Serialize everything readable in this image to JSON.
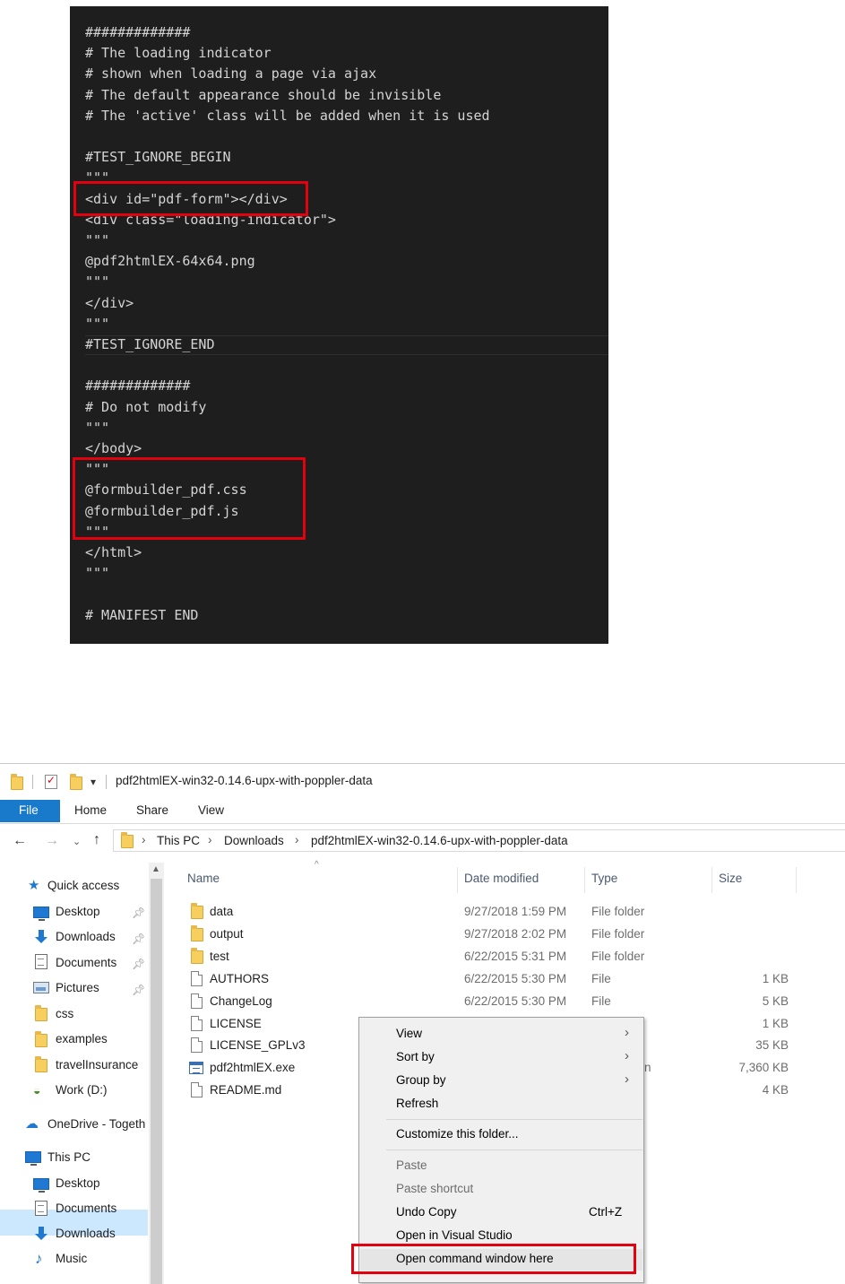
{
  "code": {
    "lines": [
      "#############",
      "# The loading indicator",
      "# shown when loading a page via ajax",
      "# The default appearance should be invisible",
      "# The 'active' class will be added when it is used",
      "",
      "#TEST_IGNORE_BEGIN",
      "\"\"\"",
      "<div id=\"pdf-form\"></div>",
      "<div class=\"loading-indicator\">",
      "\"\"\"",
      "@pdf2htmlEX-64x64.png",
      "\"\"\"",
      "</div>",
      "\"\"\"",
      "#TEST_IGNORE_END",
      "",
      "#############",
      "# Do not modify",
      "\"\"\"",
      "</body>",
      "\"\"\"",
      "@formbuilder_pdf.css",
      "@formbuilder_pdf.js",
      "\"\"\"",
      "</html>",
      "\"\"\"",
      "",
      "# MANIFEST END"
    ]
  },
  "explorer": {
    "title": "pdf2htmlEX-win32-0.14.6-upx-with-poppler-data",
    "qat_arrow": "▾",
    "ribbon_tabs": [
      "File",
      "Home",
      "Share",
      "View"
    ],
    "breadcrumb": [
      "This PC",
      "Downloads",
      "pdf2htmlEX-win32-0.14.6-upx-with-poppler-data"
    ],
    "nav": {
      "quick_access": "Quick access",
      "items": [
        "Desktop",
        "Downloads",
        "Documents",
        "Pictures",
        "css",
        "examples",
        "travelInsurance",
        "Work (D:)"
      ],
      "onedrive": "OneDrive - Togeth",
      "this_pc": "This PC",
      "pc_items": [
        "Desktop",
        "Documents",
        "Downloads",
        "Music"
      ]
    },
    "columns": {
      "name": "Name",
      "date": "Date modified",
      "type": "Type",
      "size": "Size"
    },
    "files": [
      {
        "name": "data",
        "date": "9/27/2018 1:59 PM",
        "type": "File folder",
        "size": "",
        "icon": "folder-icon"
      },
      {
        "name": "output",
        "date": "9/27/2018 2:02 PM",
        "type": "File folder",
        "size": "",
        "icon": "folder-icon"
      },
      {
        "name": "test",
        "date": "6/22/2015 5:31 PM",
        "type": "File folder",
        "size": "",
        "icon": "folder-icon"
      },
      {
        "name": "AUTHORS",
        "date": "6/22/2015 5:30 PM",
        "type": "File",
        "size": "1 KB",
        "icon": "file-icon"
      },
      {
        "name": "ChangeLog",
        "date": "6/22/2015 5:30 PM",
        "type": "File",
        "size": "5 KB",
        "icon": "file-icon"
      },
      {
        "name": "LICENSE",
        "date": "",
        "type": "",
        "size": "1 KB",
        "icon": "file-icon"
      },
      {
        "name": "LICENSE_GPLv3",
        "date": "",
        "type": "",
        "size": "35 KB",
        "icon": "file-icon"
      },
      {
        "name": "pdf2htmlEX.exe",
        "date": "",
        "type": "n",
        "size": "7,360 KB",
        "icon": "exe-icon"
      },
      {
        "name": "README.md",
        "date": "",
        "type": "",
        "size": "4 KB",
        "icon": "file-icon"
      }
    ]
  },
  "context_menu": {
    "view": "View",
    "sort_by": "Sort by",
    "group_by": "Group by",
    "refresh": "Refresh",
    "customize": "Customize this folder...",
    "paste": "Paste",
    "paste_shortcut": "Paste shortcut",
    "undo_copy": "Undo Copy",
    "undo_shortcut": "Ctrl+Z",
    "open_vs": "Open in Visual Studio",
    "open_cmd": "Open command window here"
  },
  "colors": {
    "highlight": "#e3000f",
    "file_tab": "#1979ca",
    "code_bg": "#1e1e1e"
  }
}
